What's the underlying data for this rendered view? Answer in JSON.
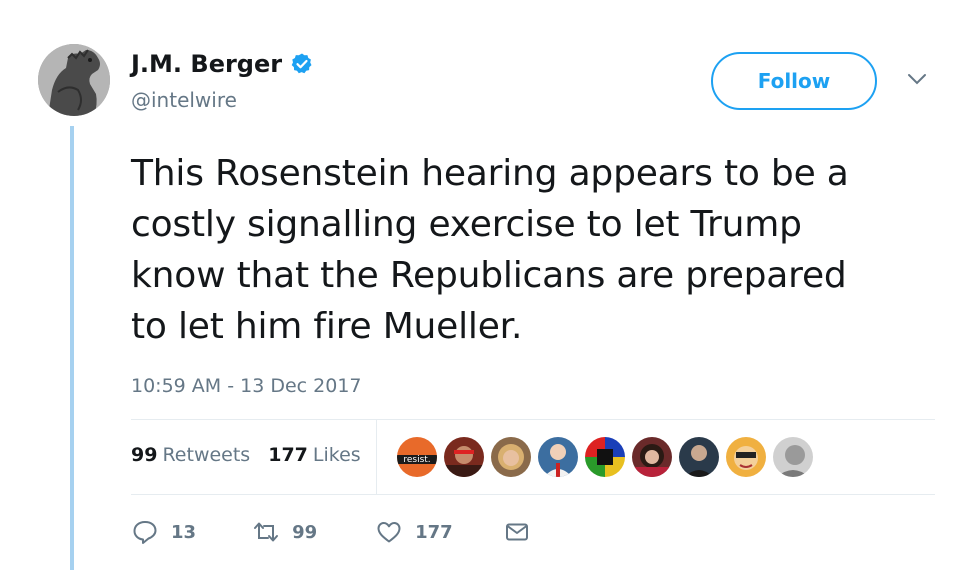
{
  "colors": {
    "accent": "#1da1f2",
    "muted": "#657786",
    "text": "#14171a",
    "thread": "#a6d1f0",
    "divider": "#e6ecf0"
  },
  "user": {
    "display_name": "J.M. Berger",
    "handle": "@intelwire",
    "verified_icon": "verified-badge-icon"
  },
  "follow_button": {
    "label": "Follow"
  },
  "tweet": {
    "lines": [
      "This Rosenstein hearing appears to be a",
      "costly signalling exercise to let Trump",
      "know that the Republicans are prepared",
      "to let him fire Mueller."
    ],
    "timestamp": "10:59 AM - 13 Dec 2017"
  },
  "stats": {
    "retweets_count": "99",
    "retweets_label": "Retweets",
    "likes_count": "177",
    "likes_label": "Likes",
    "liker_avatars": [
      {
        "icon": "resist-avatar",
        "text": "resist."
      },
      {
        "icon": "avatar-man-red"
      },
      {
        "icon": "avatar-woman-blonde"
      },
      {
        "icon": "avatar-man-suit"
      },
      {
        "icon": "avatar-colorblocks"
      },
      {
        "icon": "avatar-woman-dark-hair"
      },
      {
        "icon": "avatar-man-dark"
      },
      {
        "icon": "avatar-cartoon-face"
      },
      {
        "icon": "avatar-gray"
      }
    ]
  },
  "actions": {
    "reply_count": "13",
    "retweet_count": "99",
    "like_count": "177",
    "icons": [
      "reply-icon",
      "retweet-icon",
      "like-icon",
      "message-icon"
    ]
  }
}
